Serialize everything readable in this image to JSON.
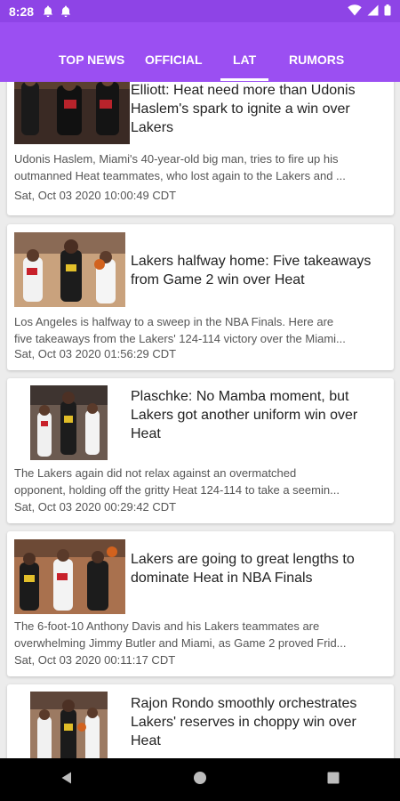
{
  "status_bar": {
    "time": "8:28"
  },
  "tabs": [
    {
      "label": "TOP NEWS",
      "active": false
    },
    {
      "label": "OFFICIAL",
      "active": false
    },
    {
      "label": "LAT",
      "active": true
    },
    {
      "label": "RUMORS",
      "active": false
    }
  ],
  "articles": [
    {
      "headline_lines": [
        "Elliott: Heat need more than Udonis",
        "Haslem's spark to ignite a win over",
        "Lakers"
      ],
      "summary_lines": [
        "Udonis Haslem, Miami's 40-year-old big man, tries to fire up his",
        "outmanned Heat teammates, who lost again to the Lakers and ..."
      ],
      "date": "Sat, Oct 03 2020 10:00:49 CDT"
    },
    {
      "headline_lines": [
        "Lakers halfway home: Five takeaways",
        "from Game 2 win over Heat"
      ],
      "summary_lines": [
        "Los Angeles is halfway to a sweep in the NBA Finals. Here are",
        "five takeaways from the Lakers' 124-114 victory over the Miami..."
      ],
      "date": "Sat, Oct 03 2020 01:56:29 CDT"
    },
    {
      "headline_lines": [
        "Plaschke: No Mamba moment, but",
        "Lakers got another uniform win over",
        "Heat"
      ],
      "summary_lines": [
        "The Lakers again did not relax against an overmatched",
        "opponent, holding off the gritty Heat 124-114 to take a seemin..."
      ],
      "date": "Sat, Oct 03 2020 00:29:42 CDT"
    },
    {
      "headline_lines": [
        "Lakers are going to great lengths to",
        "dominate Heat in NBA Finals"
      ],
      "summary_lines": [
        "The 6-foot-10 Anthony Davis and his Lakers teammates are",
        "overwhelming Jimmy Butler and Miami, as Game 2 proved Frid..."
      ],
      "date": "Sat, Oct 03 2020 00:11:17 CDT"
    },
    {
      "headline_lines": [
        "Rajon Rondo smoothly orchestrates",
        "Lakers' reserves in choppy win over",
        "Heat"
      ],
      "summary_lines": [],
      "date": ""
    }
  ],
  "colors": {
    "status_bar": "#8e44e6",
    "app_bar": "#9b4ff2",
    "nav_bar": "#000000"
  },
  "icons": [
    "notification-icon",
    "wifi-icon",
    "signal-icon",
    "battery-icon",
    "back-icon",
    "home-icon",
    "recents-icon"
  ]
}
